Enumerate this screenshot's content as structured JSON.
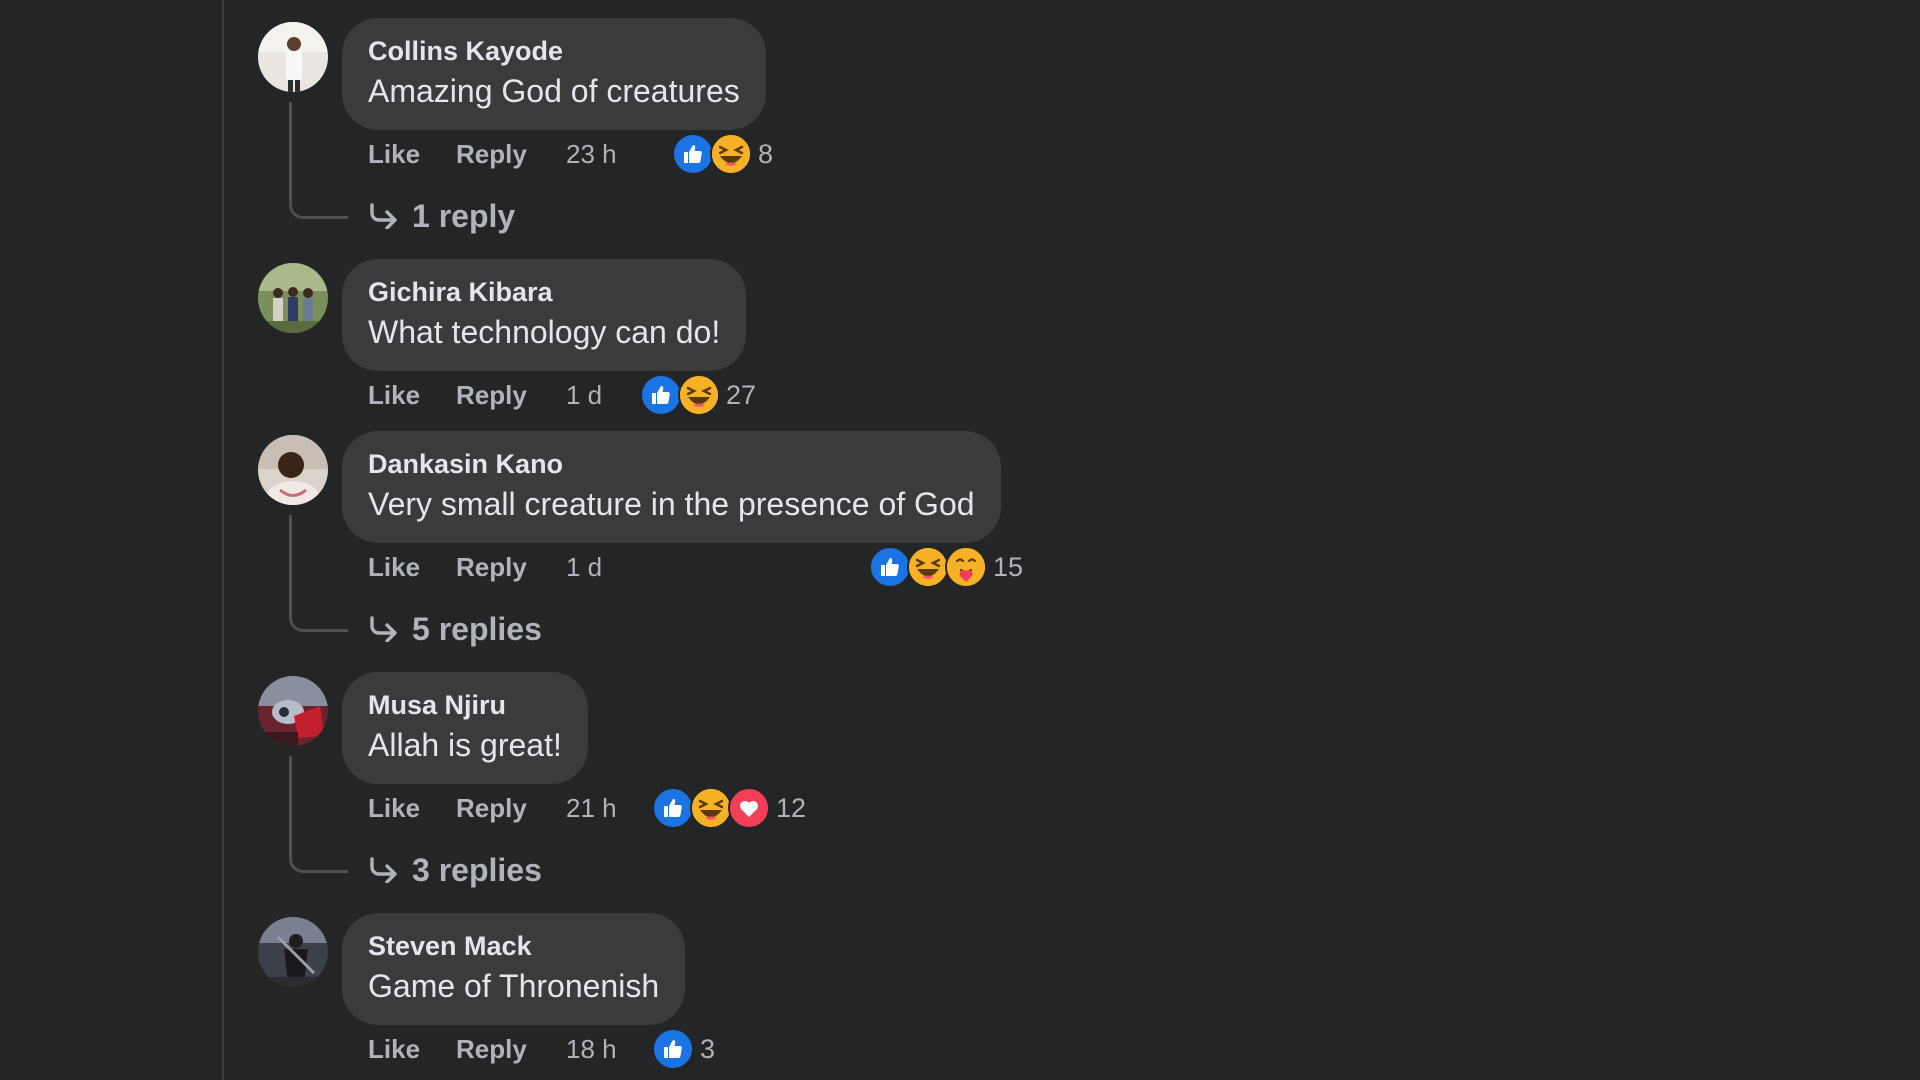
{
  "colors": {
    "background": "#242526",
    "bubble": "#3a3b3c",
    "primary_text": "#e4e6eb",
    "secondary_text": "#b0b3b8",
    "like_blue": "#1b74e4",
    "haha_yellow": "#f7b125",
    "love_red": "#f33e58"
  },
  "actions": {
    "like_label": "Like",
    "reply_label": "Reply"
  },
  "comments": [
    {
      "author": "Collins Kayode",
      "text": "Amazing God of creatures",
      "timestamp": "23 h",
      "reactions": [
        "like-icon",
        "haha-icon"
      ],
      "reaction_count": "8",
      "replies_label": "1 reply"
    },
    {
      "author": "Gichira Kibara",
      "text": "What technology can do!",
      "timestamp": "1 d",
      "reactions": [
        "like-icon",
        "haha-icon"
      ],
      "reaction_count": "27",
      "replies_label": ""
    },
    {
      "author": "Dankasin Kano",
      "text": "Very small creature in the presence of God",
      "timestamp": "1 d",
      "reactions": [
        "like-icon",
        "haha-icon",
        "care-icon"
      ],
      "reaction_count": "15",
      "replies_label": "5 replies"
    },
    {
      "author": "Musa Njiru",
      "text": "Allah is great!",
      "timestamp": "21 h",
      "reactions": [
        "like-icon",
        "haha-icon",
        "love-icon"
      ],
      "reaction_count": "12",
      "replies_label": "3 replies"
    },
    {
      "author": "Steven Mack",
      "text": "Game of Thronenish",
      "timestamp": "18 h",
      "reactions": [
        "like-icon"
      ],
      "reaction_count": "3",
      "replies_label": ""
    }
  ]
}
